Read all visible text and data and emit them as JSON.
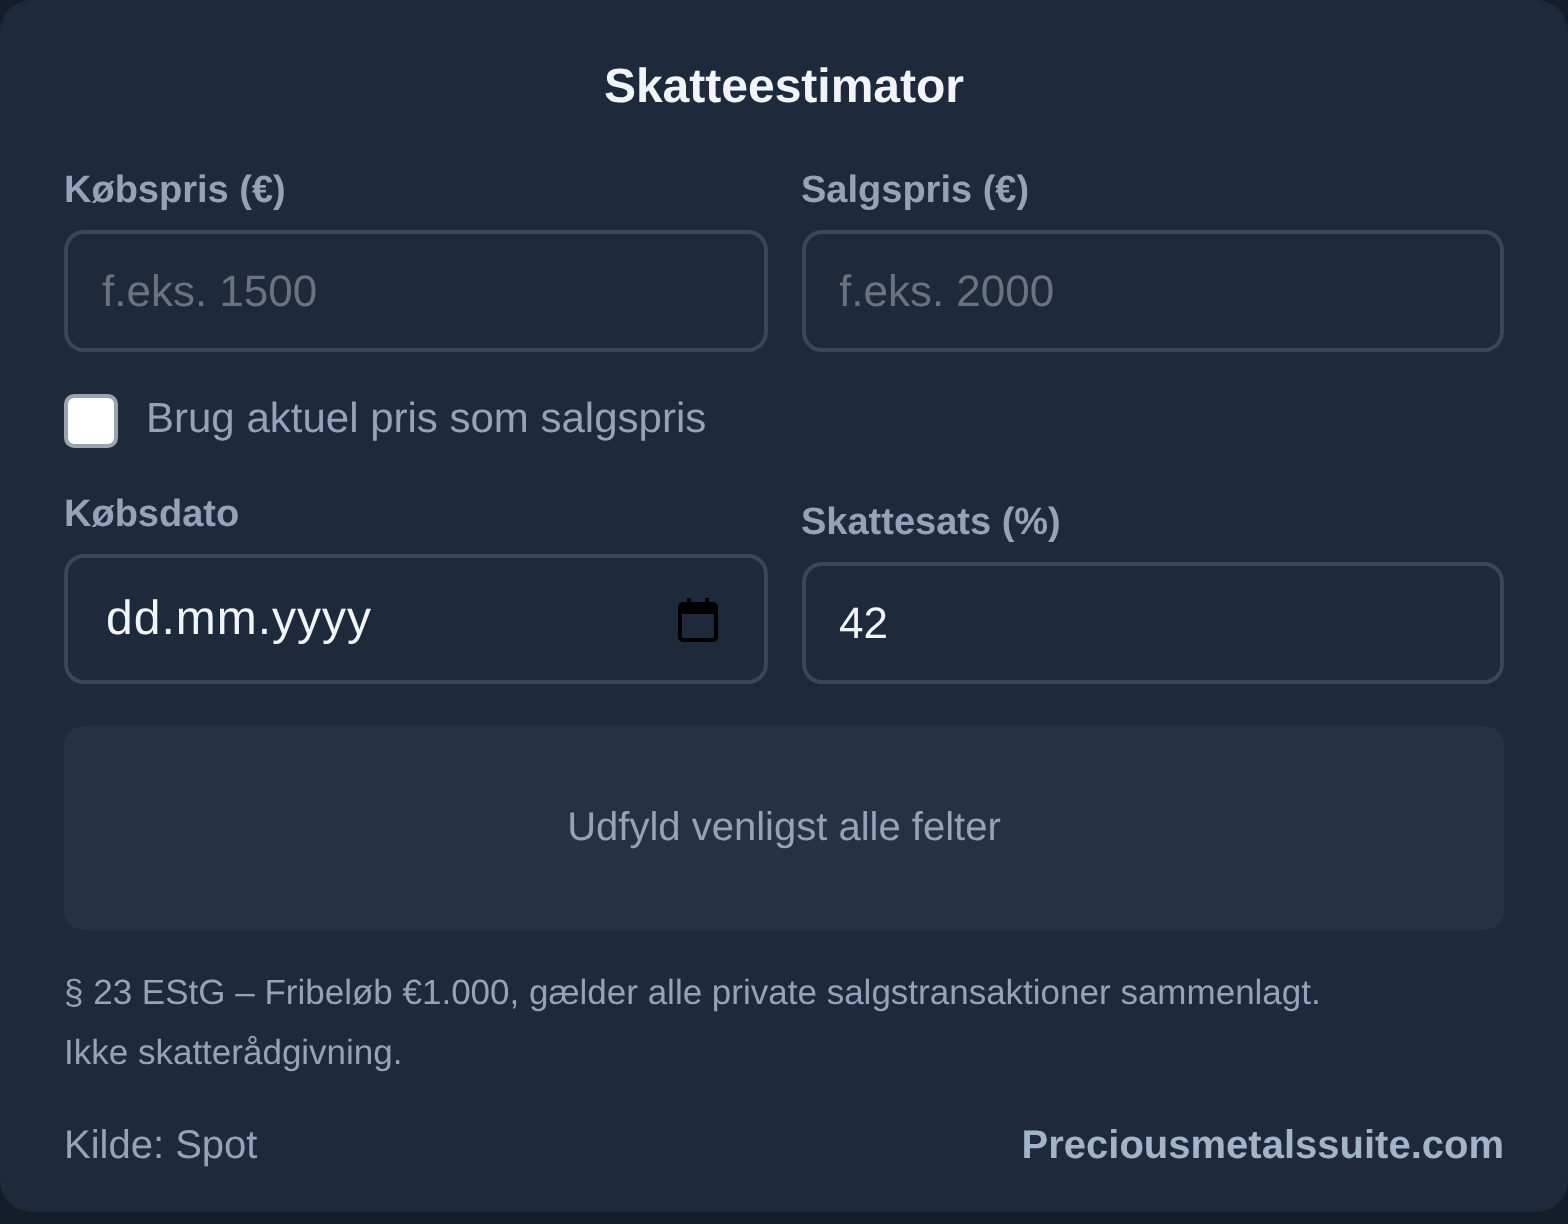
{
  "title": "Skatteestimator",
  "price_fields": [
    {
      "kind": "number",
      "label": "Købspris (€)",
      "placeholder": "f.eks. 1500"
    },
    {
      "kind": "number",
      "label": "Salgspris (€)",
      "placeholder": "f.eks. 2000"
    }
  ],
  "checkbox": {
    "label": "Brug aktuel pris som salgspris",
    "checked": false
  },
  "detail_fields": [
    {
      "kind": "date",
      "label": "Købsdato",
      "value": "dd.mm.yyyy"
    },
    {
      "kind": "number",
      "label": "Skattesats (%)",
      "value": "42"
    }
  ],
  "result": {
    "message": "Udfyld venligst alle felter"
  },
  "note": "§ 23 EStG – Fribeløb €1.000, gælder alle private salgstransaktioner sammenlagt. Ikke skatterådgivning.",
  "footer": {
    "source": "Kilde: Spot",
    "link": "Preciousmetalssuite.com"
  }
}
